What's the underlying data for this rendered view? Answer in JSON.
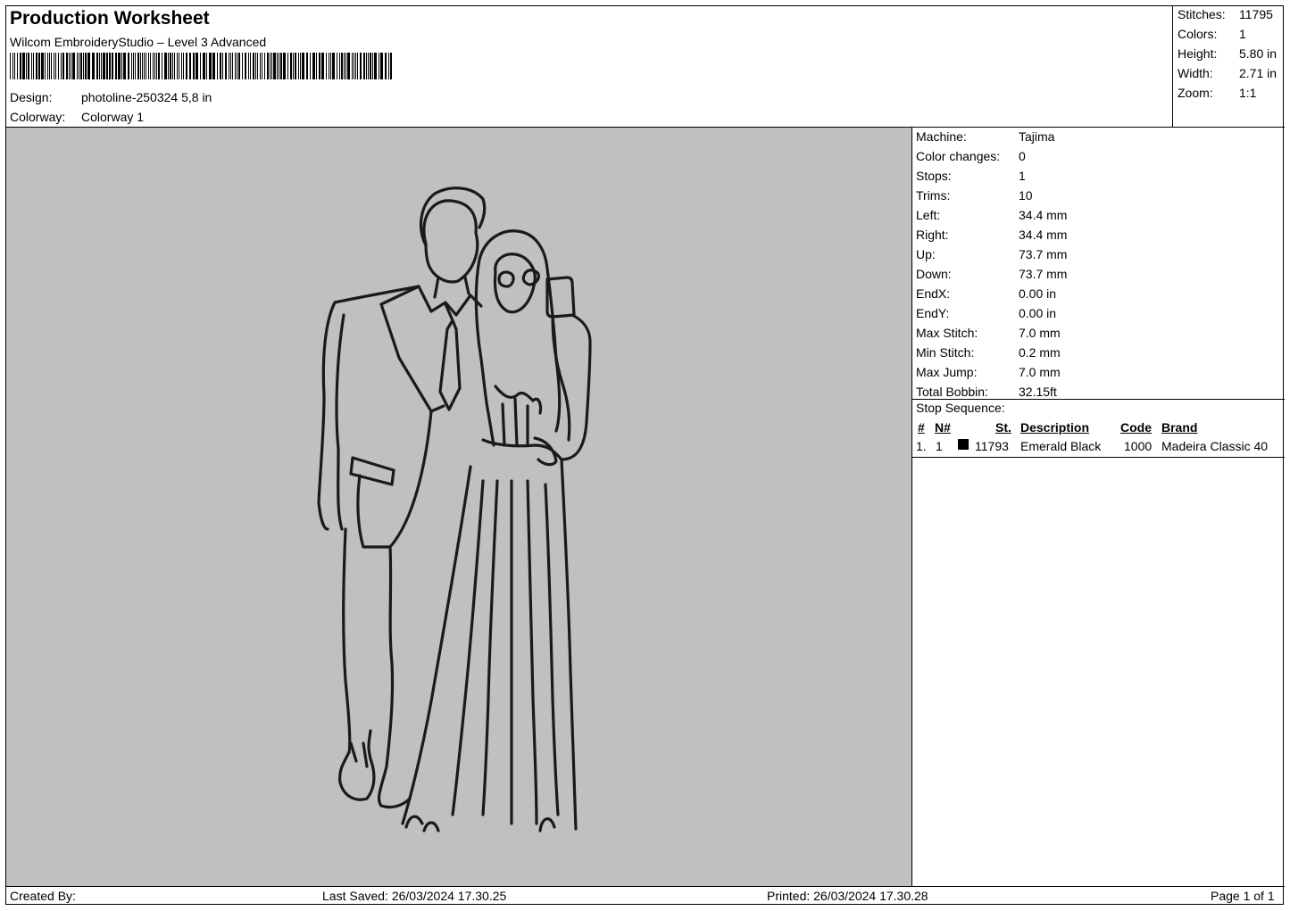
{
  "header": {
    "title": "Production Worksheet",
    "software": "Wilcom EmbroideryStudio – Level 3 Advanced",
    "design_label": "Design:",
    "design_value": "photoline-250324 5,8 in",
    "colorway_label": "Colorway:",
    "colorway_value": "Colorway 1"
  },
  "stats": [
    {
      "label": "Stitches:",
      "value": "11795"
    },
    {
      "label": "Colors:",
      "value": "1"
    },
    {
      "label": "Height:",
      "value": "5.80 in"
    },
    {
      "label": "Width:",
      "value": "2.71 in"
    },
    {
      "label": "Zoom:",
      "value": "1:1"
    }
  ],
  "machine_info": [
    {
      "label": "Machine:",
      "value": "Tajima"
    },
    {
      "label": "Color changes:",
      "value": "0"
    },
    {
      "label": "Stops:",
      "value": "1"
    },
    {
      "label": "Trims:",
      "value": "10"
    },
    {
      "label": "Left:",
      "value": "34.4 mm"
    },
    {
      "label": "Right:",
      "value": "34.4 mm"
    },
    {
      "label": "Up:",
      "value": "73.7 mm"
    },
    {
      "label": "Down:",
      "value": "73.7 mm"
    },
    {
      "label": "EndX:",
      "value": "0.00 in"
    },
    {
      "label": "EndY:",
      "value": "0.00 in"
    },
    {
      "label": "Max Stitch:",
      "value": "7.0 mm"
    },
    {
      "label": "Min Stitch:",
      "value": "0.2 mm"
    },
    {
      "label": "Max Jump:",
      "value": "7.0 mm"
    },
    {
      "label": "Total Bobbin:",
      "value": "32.15ft"
    }
  ],
  "stop_sequence": {
    "title": "Stop Sequence:",
    "columns": [
      "#",
      "N#",
      "St.",
      "Description",
      "Code",
      "Brand"
    ],
    "rows": [
      {
        "index": "1.",
        "needle": "1",
        "stitches": "11793",
        "description": "Emerald Black",
        "code": "1000",
        "brand": "Madeira Classic 40",
        "color": "#000000"
      }
    ]
  },
  "preview": {
    "background_color": "#c0c0c0",
    "thread_color": "#1a1a1a"
  },
  "footer": {
    "created_by": "Created By:",
    "last_saved": "Last Saved: 26/03/2024 17.30.25",
    "printed": "Printed: 26/03/2024 17.30.28",
    "page": "Page 1 of 1"
  }
}
